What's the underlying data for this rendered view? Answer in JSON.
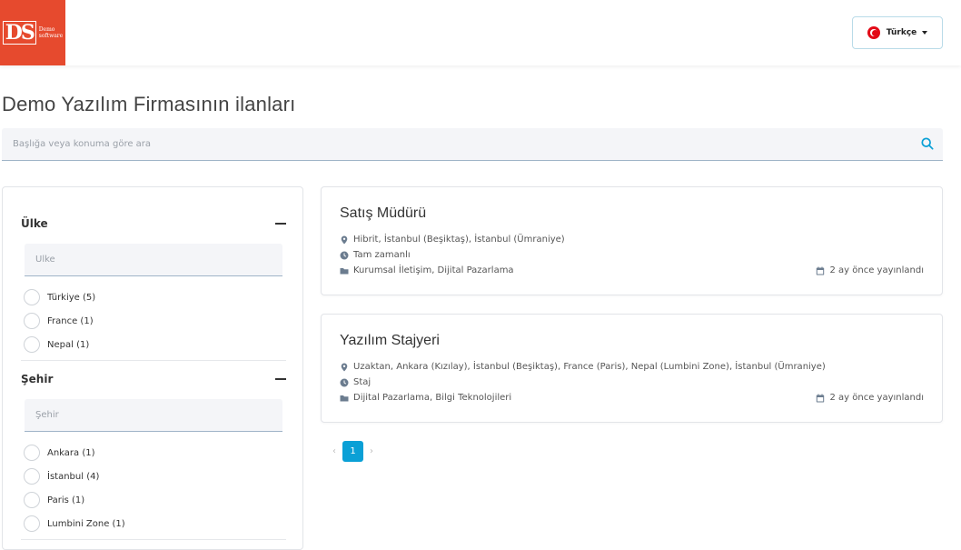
{
  "header": {
    "logo": {
      "mark": "DS",
      "text_line1": "Demo",
      "text_line2": "software"
    },
    "language": {
      "label": "Türkçe",
      "flag": "flag-tr-icon"
    }
  },
  "page": {
    "title": "Demo Yazılım Firmasının ilanları",
    "search_placeholder": "Başlığa veya konuma göre ara"
  },
  "filters": {
    "country": {
      "title": "Ülke",
      "placeholder": "Ülke",
      "options": [
        {
          "label": "Türkiye (5)"
        },
        {
          "label": "France (1)"
        },
        {
          "label": "Nepal (1)"
        }
      ]
    },
    "city": {
      "title": "Şehir",
      "placeholder": "Şehir",
      "options": [
        {
          "label": "Ankara (1)"
        },
        {
          "label": "İstanbul (4)"
        },
        {
          "label": "Paris (1)"
        },
        {
          "label": "Lumbini Zone (1)"
        }
      ]
    }
  },
  "jobs": [
    {
      "title": "Satış Müdürü",
      "location": "Hibrit, İstanbul (Beşiktaş), İstanbul (Ümraniye)",
      "type": "Tam zamanlı",
      "departments": "Kurumsal İletişim, Dijital Pazarlama",
      "posted": "2 ay önce yayınlandı"
    },
    {
      "title": "Yazılım Stajyeri",
      "location": "Uzaktan, Ankara (Kızılay), İstanbul (Beşiktaş), France (Paris), Nepal (Lumbini Zone), İstanbul (Ümraniye)",
      "type": "Staj",
      "departments": "Dijital Pazarlama, Bilgi Teknolojileri",
      "posted": "2 ay önce yayınlandı"
    }
  ],
  "pagination": {
    "prev": "‹",
    "current": "1",
    "next": "›"
  },
  "colors": {
    "brand": "#e64a2e",
    "accent": "#0aa0d6",
    "icon": "#6b7c8f"
  }
}
